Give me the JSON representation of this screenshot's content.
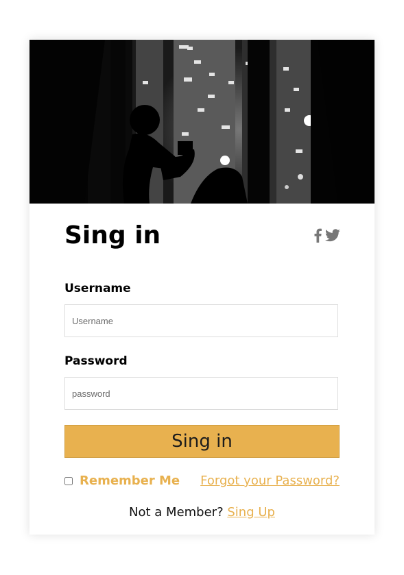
{
  "form": {
    "title": "Sing in",
    "username_label": "Username",
    "username_placeholder": "Username",
    "password_label": "Password",
    "password_placeholder": "password",
    "submit_label": "Sing in",
    "remember_label": "Remember Me",
    "forgot_link": "Forgot your Password?",
    "member_text": "Not a Member? ",
    "signup_link": "Sing Up"
  },
  "social": [
    "facebook-icon",
    "twitter-icon"
  ],
  "colors": {
    "accent": "#e8b14f",
    "icon_gray": "#777777",
    "border": "#dcdcdc"
  }
}
